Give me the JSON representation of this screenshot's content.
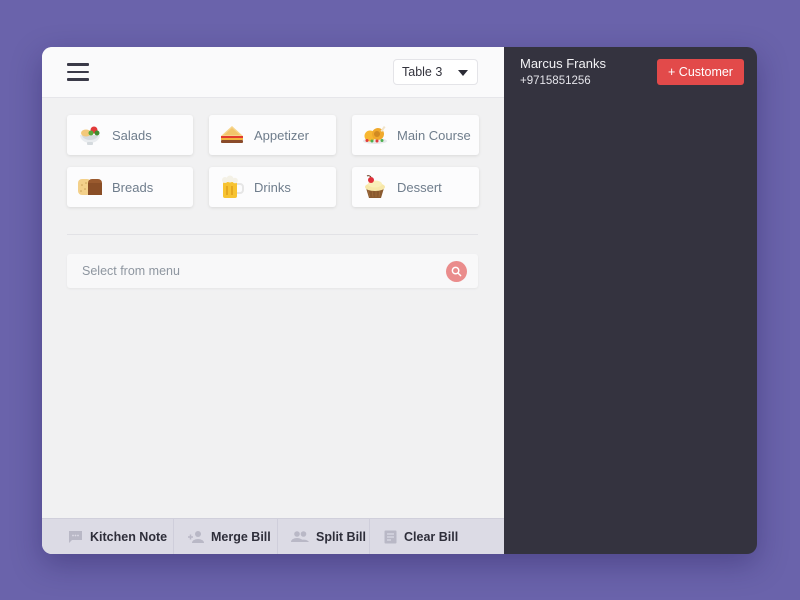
{
  "header": {
    "menu_icon": "hamburger-icon",
    "table_select": {
      "value": "Table 3",
      "icon": "caret-down-icon"
    }
  },
  "categories": [
    {
      "label": "Salads",
      "icon": "salad-icon"
    },
    {
      "label": "Appetizer",
      "icon": "sandwich-icon"
    },
    {
      "label": "Main Course",
      "icon": "roast-chicken-icon"
    },
    {
      "label": "Breads",
      "icon": "bread-icon"
    },
    {
      "label": "Drinks",
      "icon": "beer-mug-icon"
    },
    {
      "label": "Dessert",
      "icon": "cupcake-icon"
    }
  ],
  "search": {
    "placeholder": "Select from menu",
    "value": "",
    "icon": "search-icon"
  },
  "actions": [
    {
      "label": "Kitchen Note",
      "icon": "message-icon"
    },
    {
      "label": "Merge Bill",
      "icon": "add-person-icon"
    },
    {
      "label": "Split Bill",
      "icon": "people-icon"
    },
    {
      "label": "Clear Bill",
      "icon": "document-icon"
    }
  ],
  "customer": {
    "name": "Marcus Franks",
    "phone": "+9715851256",
    "add_button_label": "+ Customer"
  },
  "colors": {
    "background": "#6a63ab",
    "sidebar_dark": "#34333f",
    "accent_red": "#e24a4a",
    "search_button": "#ea8c8c"
  }
}
